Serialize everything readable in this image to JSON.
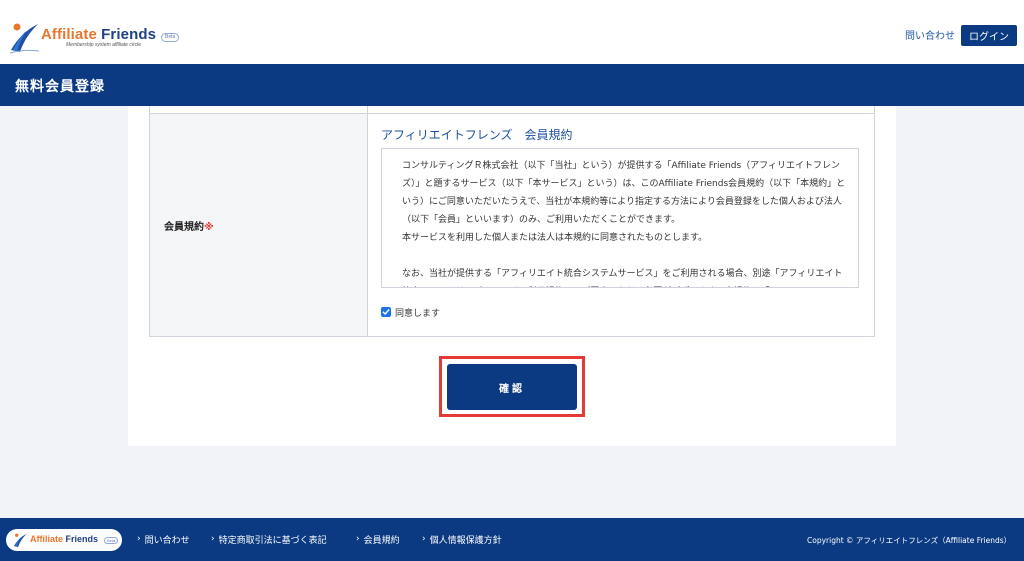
{
  "header": {
    "logo_text_first": "Affiliate",
    "logo_text_rest": " Friends",
    "logo_tagline": "Membership system affiliate circle",
    "logo_badge": "Beta",
    "contact_link": "問い合わせ",
    "login_label": "ログイン"
  },
  "title_bar": {
    "title": "無料会員登録"
  },
  "form": {
    "row_label": "会員規約",
    "required_mark": "※",
    "terms_heading": "アフィリエイトフレンズ　会員規約",
    "terms_paragraph_1": "コンサルティングＲ株式会社（以下「当社」という）が提供する「Affiliate Friends（アフィリエイトフレンズ）」と題するサービス（以下「本サービス」という）は、このAffiliate Friends会員規約（以下「本規約」という）にご同意いただいたうえで、当社が本規約等により指定する方法により会員登録をした個人および法人（以下「会員」といいます）のみ、ご利用いただくことができます。",
    "terms_paragraph_2": "本サービスを利用した個人または法人は本規約に同意されたものとします。",
    "terms_paragraph_3": "なお、当社が提供する「アフィリエイト統合システムサービス」をご利用される場合、別途「アフィリエイト統合システムサービスユーザー利用規約」にご同意いただく必要がございます。本規約と「アフィリ",
    "agree_label": "同意します",
    "agree_checked": true,
    "confirm_label": "確認"
  },
  "footer": {
    "logo_text_first": "Affiliate",
    "logo_text_rest": " Friends",
    "logo_badge": "Beta",
    "nav": [
      {
        "chev": "›",
        "label": "問い合わせ"
      },
      {
        "chev": "›",
        "label": "特定商取引法に基づく表記"
      },
      {
        "chev": "›",
        "label": "会員規約"
      },
      {
        "chev": "›",
        "label": "個人情報保護方針"
      }
    ],
    "copyright": "Copyright © アフィリエイトフレンズ（Affiliate Friends）"
  },
  "colors": {
    "brand_navy": "#0b3a82",
    "accent_orange": "#e8772e",
    "required_red": "#e53935",
    "link_blue": "#1c5aa6"
  },
  "icons": {
    "logo": "figure-logo-icon",
    "checkbox": "checkmark-icon",
    "footer_chevron": "chevron-right-icon"
  }
}
